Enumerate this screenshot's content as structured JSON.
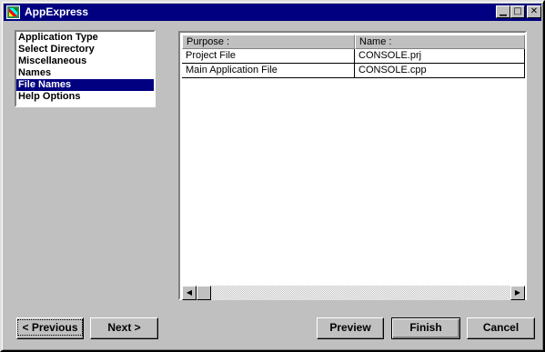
{
  "window": {
    "title": "AppExpress"
  },
  "titlebar": {
    "minimize_glyph": "▁",
    "maximize_glyph": "□",
    "close_glyph": "✕"
  },
  "nav": {
    "items": [
      {
        "label": "Application Type"
      },
      {
        "label": "Select Directory"
      },
      {
        "label": "Miscellaneous"
      },
      {
        "label": "Names"
      },
      {
        "label": "File Names",
        "selected": true
      },
      {
        "label": "Help Options"
      }
    ]
  },
  "grid": {
    "headers": [
      "Purpose :",
      "Name :"
    ],
    "rows": [
      [
        "Project File",
        "CONSOLE.prj"
      ],
      [
        "Main Application File",
        "CONSOLE.cpp"
      ]
    ]
  },
  "scrollbar": {
    "left_glyph": "◀",
    "right_glyph": "▶"
  },
  "buttons": {
    "previous": "< Previous",
    "next": "Next >",
    "preview": "Preview",
    "finish": "Finish",
    "cancel": "Cancel"
  }
}
